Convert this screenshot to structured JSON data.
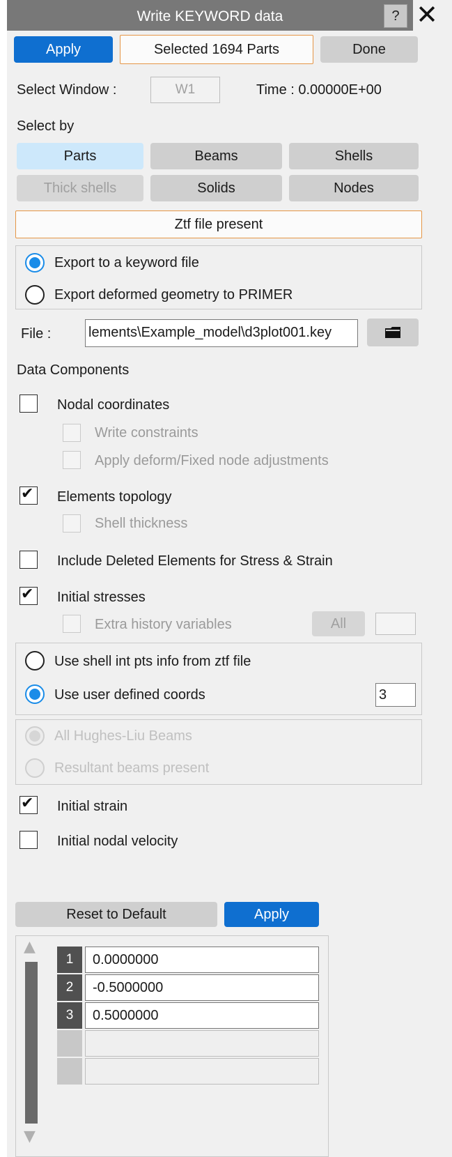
{
  "window": {
    "title": "Write KEYWORD data",
    "help_label": "?",
    "close_label": "✕"
  },
  "top_buttons": {
    "apply": "Apply",
    "selected": "Selected 1694 Parts",
    "done": "Done"
  },
  "select_window": {
    "label": "Select Window :",
    "value": "W1",
    "time_label": "Time : 0.00000E+00"
  },
  "select_by": {
    "label": "Select by",
    "options": [
      "Parts",
      "Beams",
      "Shells",
      "Thick shells",
      "Solids",
      "Nodes"
    ]
  },
  "ztf_button": "Ztf file present",
  "export": {
    "options": [
      "Export to a keyword file",
      "Export deformed geometry to PRIMER"
    ],
    "selected_index": 0
  },
  "file": {
    "label": "File :",
    "value": "lements\\Example_model\\d3plot001.key",
    "browse_icon": "folder-icon"
  },
  "data_components": {
    "heading": "Data Components",
    "nodal_coordinates": "Nodal coordinates",
    "write_constraints": "Write constraints",
    "apply_deform": "Apply deform/Fixed node adjustments",
    "elements_topology": "Elements topology",
    "shell_thickness": "Shell thickness",
    "include_deleted": "Include Deleted Elements for Stress & Strain",
    "initial_stresses": "Initial stresses",
    "extra_history": "Extra history variables",
    "all_button": "All",
    "extra_history_value": "",
    "initial_strain": "Initial strain",
    "initial_nodal_velocity": "Initial nodal velocity"
  },
  "checked": {
    "nodal_coordinates": false,
    "write_constraints": false,
    "apply_deform": false,
    "elements_topology": true,
    "shell_thickness": false,
    "include_deleted": false,
    "initial_stresses": true,
    "extra_history": false,
    "initial_strain": true,
    "initial_nodal_velocity": false
  },
  "shell_int_pts": {
    "options": [
      "Use shell int pts info from ztf file",
      "Use user defined coords"
    ],
    "selected_index": 1,
    "coords_count": "3"
  },
  "beams": {
    "options": [
      "All Hughes-Liu Beams",
      "Resultant beams present"
    ],
    "selected_index": 0
  },
  "bottom_buttons": {
    "reset": "Reset to Default",
    "apply": "Apply"
  },
  "coords_table": {
    "rows": [
      {
        "index": "1",
        "value": "0.0000000"
      },
      {
        "index": "2",
        "value": "-0.5000000"
      },
      {
        "index": "3",
        "value": "0.5000000"
      },
      {
        "index": "",
        "value": ""
      },
      {
        "index": "",
        "value": ""
      }
    ]
  },
  "colors": {
    "accent_blue": "#0f6fd0",
    "radio_blue": "#1a8ce8",
    "orange_border": "#e59545",
    "selected_light_blue": "#cde8fb"
  }
}
